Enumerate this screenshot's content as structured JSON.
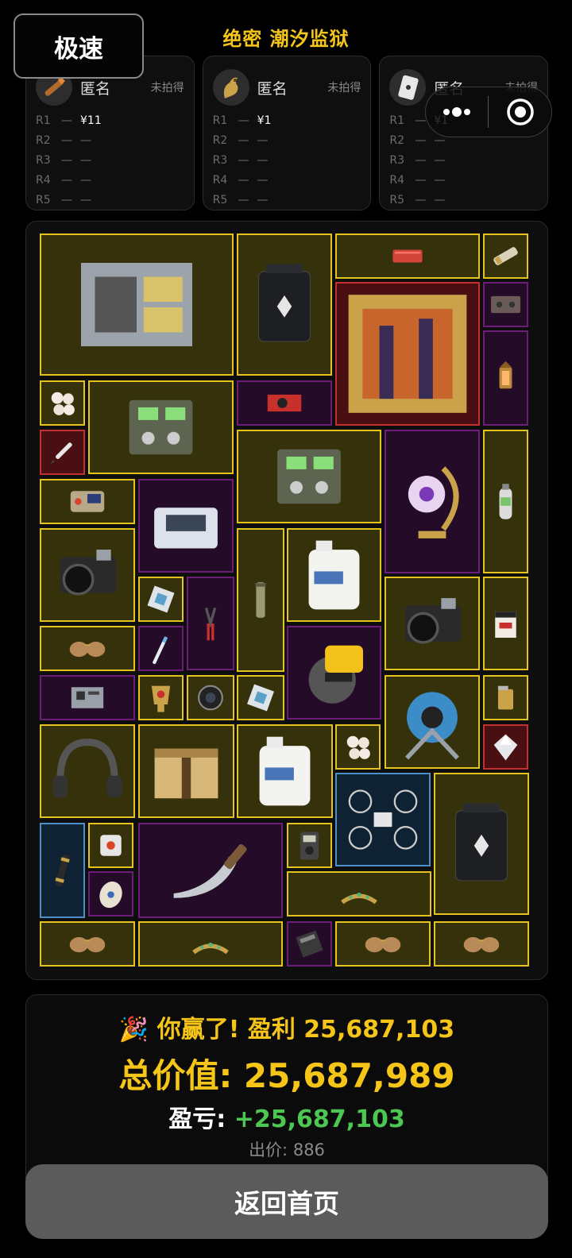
{
  "header": {
    "speed_button": "极速",
    "title": "绝密 潮汐监狱"
  },
  "capsule": {
    "more_icon": "more-dots-icon",
    "close_icon": "record-target-icon"
  },
  "bidders": [
    {
      "name": "匿名",
      "status": "未拍得",
      "avatar_icon": "cigar-icon",
      "rounds": [
        {
          "label": "R1",
          "dash": "—",
          "amount": "¥11"
        },
        {
          "label": "R2",
          "dash": "—",
          "amount": "—"
        },
        {
          "label": "R3",
          "dash": "—",
          "amount": "—"
        },
        {
          "label": "R4",
          "dash": "—",
          "amount": "—"
        },
        {
          "label": "R5",
          "dash": "—",
          "amount": "—"
        }
      ]
    },
    {
      "name": "匿名",
      "status": "未拍得",
      "avatar_icon": "golden-dragon-icon",
      "rounds": [
        {
          "label": "R1",
          "dash": "—",
          "amount": "¥1"
        },
        {
          "label": "R2",
          "dash": "—",
          "amount": "—"
        },
        {
          "label": "R3",
          "dash": "—",
          "amount": "—"
        },
        {
          "label": "R4",
          "dash": "—",
          "amount": "—"
        },
        {
          "label": "R5",
          "dash": "—",
          "amount": "—"
        }
      ]
    },
    {
      "name": "匿名",
      "status": "未拍得",
      "avatar_icon": "playing-card-icon",
      "rounds": [
        {
          "label": "R1",
          "dash": "—",
          "amount": "¥1"
        },
        {
          "label": "R2",
          "dash": "—",
          "amount": "—"
        },
        {
          "label": "R3",
          "dash": "—",
          "amount": "—"
        },
        {
          "label": "R4",
          "dash": "—",
          "amount": "—"
        },
        {
          "label": "R5",
          "dash": "—",
          "amount": "—"
        }
      ]
    }
  ],
  "result": {
    "win_prefix": "🎉 你赢了! 盈利 ",
    "win_profit": "25,687,103",
    "total_label": "总价值: ",
    "total_value": "25,687,989",
    "pnl_label": "盈亏: ",
    "pnl_value": "+25,687,103",
    "bid_label": "出价: ",
    "bid_value": "886"
  },
  "home_button": "返回首页",
  "colors": {
    "accent_gold": "#f5c518",
    "gain_green": "#4cc752",
    "tier_gold": "#e4c31e",
    "tier_purple": "#6c1d78",
    "tier_red": "#c23030",
    "tier_blue": "#4a8fc8"
  },
  "loot_items": [
    {
      "id": "server-rack-icon",
      "tier": "gold"
    },
    {
      "id": "power-station-icon",
      "tier": "gold"
    },
    {
      "id": "ammo-case-icon",
      "tier": "gold"
    },
    {
      "id": "capacitor-icon",
      "tier": "gold"
    },
    {
      "id": "framed-painting-icon",
      "tier": "red"
    },
    {
      "id": "cassette-icon",
      "tier": "purple"
    },
    {
      "id": "lantern-icon",
      "tier": "purple"
    },
    {
      "id": "pearls-icon",
      "tier": "gold"
    },
    {
      "id": "field-radio-icon",
      "tier": "gold"
    },
    {
      "id": "graphics-card-icon",
      "tier": "purple"
    },
    {
      "id": "pen-icon",
      "tier": "red"
    },
    {
      "id": "field-radio-icon",
      "tier": "gold"
    },
    {
      "id": "moon-lamp-icon",
      "tier": "purple"
    },
    {
      "id": "oxygen-tank-icon",
      "tier": "gold"
    },
    {
      "id": "handheld-device-icon",
      "tier": "gold"
    },
    {
      "id": "printer-icon",
      "tier": "purple"
    },
    {
      "id": "camera-icon",
      "tier": "gold"
    },
    {
      "id": "scroll-tube-icon",
      "tier": "gold"
    },
    {
      "id": "jerry-can-icon",
      "tier": "gold"
    },
    {
      "id": "cpu-chip-icon",
      "tier": "gold"
    },
    {
      "id": "wire-cutter-icon",
      "tier": "purple"
    },
    {
      "id": "camera-icon",
      "tier": "gold"
    },
    {
      "id": "coffee-box-icon",
      "tier": "gold"
    },
    {
      "id": "sunglasses-icon",
      "tier": "gold"
    },
    {
      "id": "toothbrush-icon",
      "tier": "purple"
    },
    {
      "id": "circular-saw-icon",
      "tier": "purple"
    },
    {
      "id": "circuit-board-icon",
      "tier": "purple"
    },
    {
      "id": "golden-cup-icon",
      "tier": "gold"
    },
    {
      "id": "lens-icon",
      "tier": "gold"
    },
    {
      "id": "cpu-chip-icon",
      "tier": "gold"
    },
    {
      "id": "cable-reel-icon",
      "tier": "gold"
    },
    {
      "id": "lighter-icon",
      "tier": "gold"
    },
    {
      "id": "headset-icon",
      "tier": "gold"
    },
    {
      "id": "supply-crate-icon",
      "tier": "gold"
    },
    {
      "id": "jerry-can-icon",
      "tier": "gold"
    },
    {
      "id": "pearls-icon",
      "tier": "gold"
    },
    {
      "id": "diamond-icon",
      "tier": "red"
    },
    {
      "id": "drone-icon",
      "tier": "blue"
    },
    {
      "id": "power-station-icon",
      "tier": "gold"
    },
    {
      "id": "telescope-icon",
      "tier": "blue"
    },
    {
      "id": "cube-icon",
      "tier": "gold"
    },
    {
      "id": "knife-icon",
      "tier": "purple"
    },
    {
      "id": "multimeter-icon",
      "tier": "gold"
    },
    {
      "id": "egg-icon",
      "tier": "purple"
    },
    {
      "id": "tiara-icon",
      "tier": "gold"
    },
    {
      "id": "sunglasses-icon",
      "tier": "gold"
    },
    {
      "id": "tiara-icon",
      "tier": "gold"
    },
    {
      "id": "hard-drive-icon",
      "tier": "purple"
    },
    {
      "id": "sunglasses-icon",
      "tier": "gold"
    },
    {
      "id": "sunglasses-icon",
      "tier": "gold"
    }
  ]
}
